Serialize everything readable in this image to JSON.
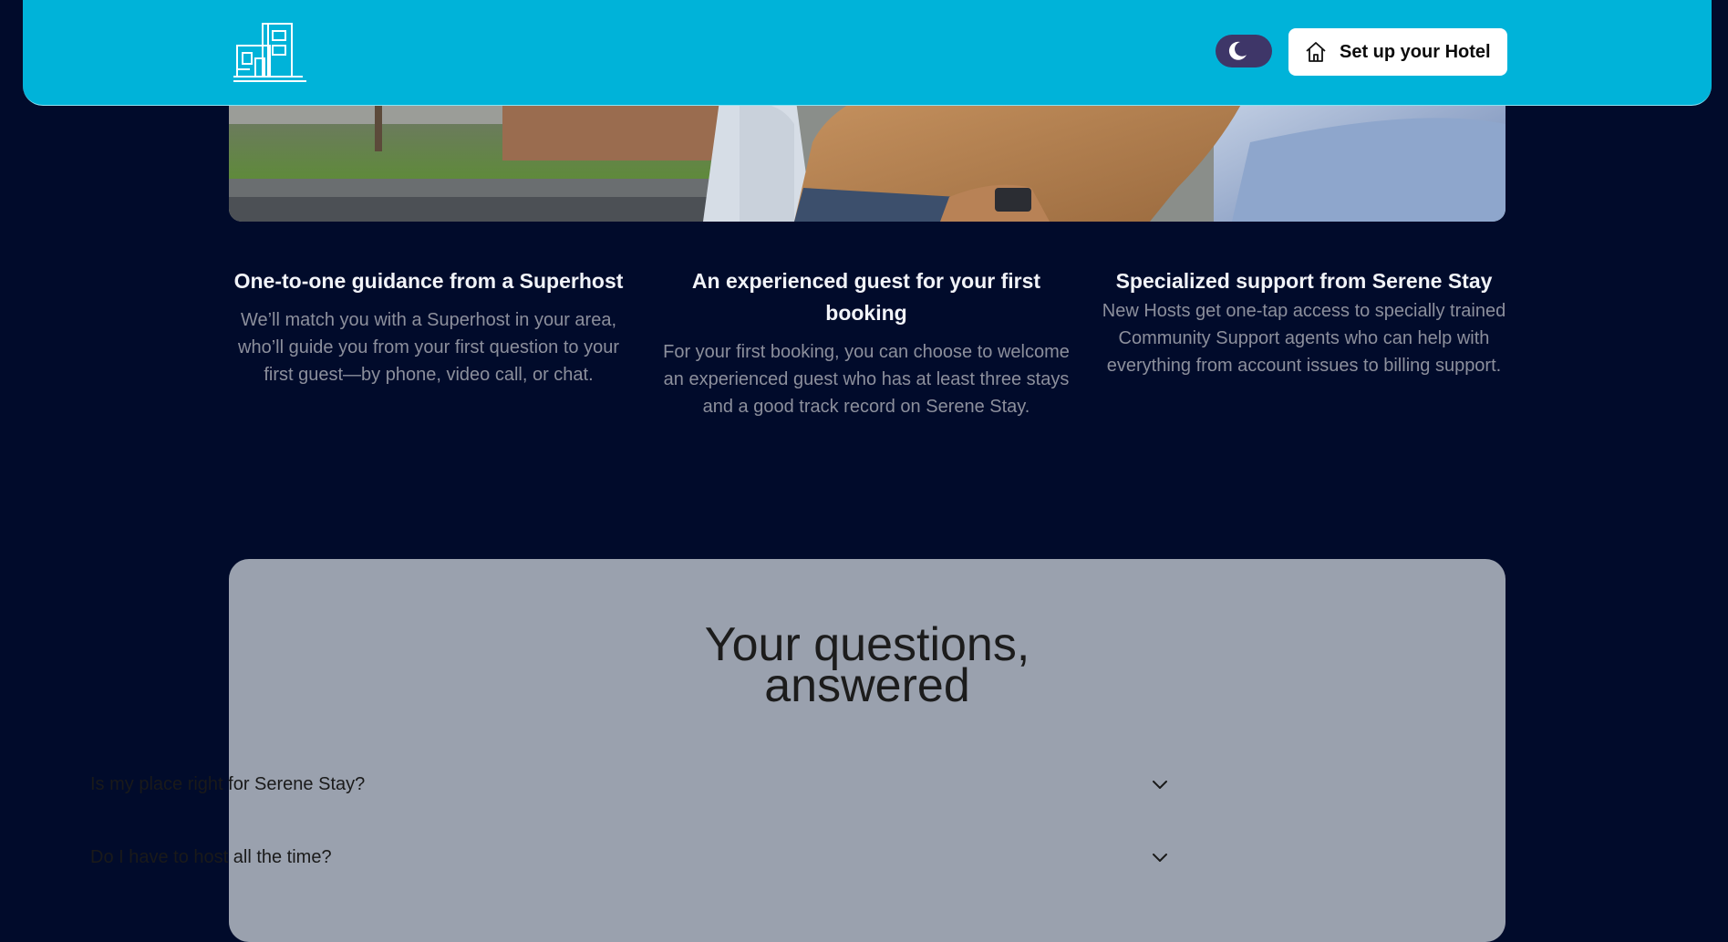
{
  "header": {
    "logo_icon": "hotel-building-logo",
    "theme_toggle_icon": "moon-icon",
    "setup_button": {
      "icon": "home-icon",
      "label": "Set up your Hotel"
    }
  },
  "features": [
    {
      "title": "One-to-one guidance from a Superhost",
      "text": "We’ll match you with a Superhost in your area, who’ll guide you from your first question to your first guest—by phone, video call, or chat."
    },
    {
      "title": "An experienced guest for your first booking",
      "text": "For your first booking, you can choose to welcome an experienced guest who has at least three stays and a good track record on Serene Stay."
    },
    {
      "title": "Specialized support from Serene Stay",
      "text": "New Hosts get one-tap access to specially trained Community Support agents who can help with everything from account issues to billing support."
    }
  ],
  "faq": {
    "title_line1": "Your questions,",
    "title_line2": "answered",
    "items": [
      {
        "question": "Is my place right for Serene Stay?",
        "icon": "chevron-down-icon"
      },
      {
        "question": "Do I have to host all the time?",
        "icon": "chevron-down-icon"
      }
    ]
  },
  "colors": {
    "page_background": "#010b2b",
    "header_background": "#00b3d9",
    "toggle_background": "#3e3668",
    "faq_background": "#9aa1ae"
  }
}
